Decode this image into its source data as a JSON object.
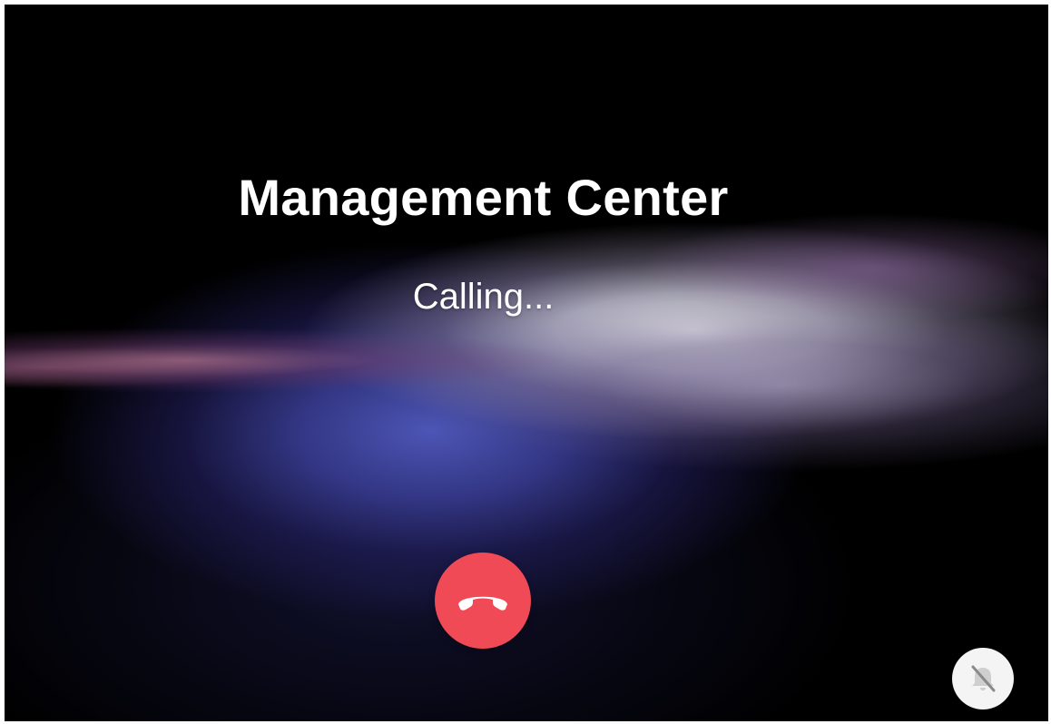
{
  "call": {
    "caller_name": "Management Center",
    "status": "Calling..."
  },
  "controls": {
    "hangup_icon": "phone-hangup-icon",
    "hangup_color": "#ef4a55",
    "mute_icon": "bell-off-icon",
    "mute_bg_color": "#f4f4f4"
  },
  "theme": {
    "background": "#000000",
    "glow_blue": "#4f56b8",
    "glow_white": "#e8e8ee",
    "text_color": "#ffffff"
  }
}
